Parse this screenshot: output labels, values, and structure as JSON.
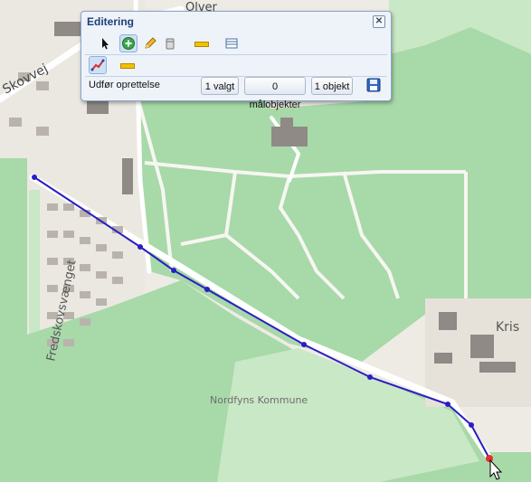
{
  "panel": {
    "title": "Editering",
    "close_glyph": "✕",
    "toolbar_row1": [
      "select-arrow-icon",
      "add-feature-icon",
      "pencil-icon",
      "eraser-icon",
      "line-icon",
      "table-icon"
    ],
    "toolbar_row2": [
      "draw-route-icon",
      "line-icon"
    ],
    "execute_label": "Udfør oprettelse",
    "selected_label": "1 valgt",
    "target_label": "0 målobjekter",
    "object_label": "1 objekt",
    "save_icon": "save-icon"
  },
  "map": {
    "labels": {
      "road_top": "Skovvej",
      "road_top2": "Olver",
      "street_left": "Fredskovsvænget",
      "municipality": "Nordfyns Kommune",
      "town_right": "Kris"
    },
    "colors": {
      "forest": "#a7d9a9",
      "forest_dark": "#8ccb91",
      "meadow": "#c9e8c5",
      "background": "#eeebe4",
      "route_line": "#2a1ec4",
      "end_point": "#e53030"
    }
  }
}
